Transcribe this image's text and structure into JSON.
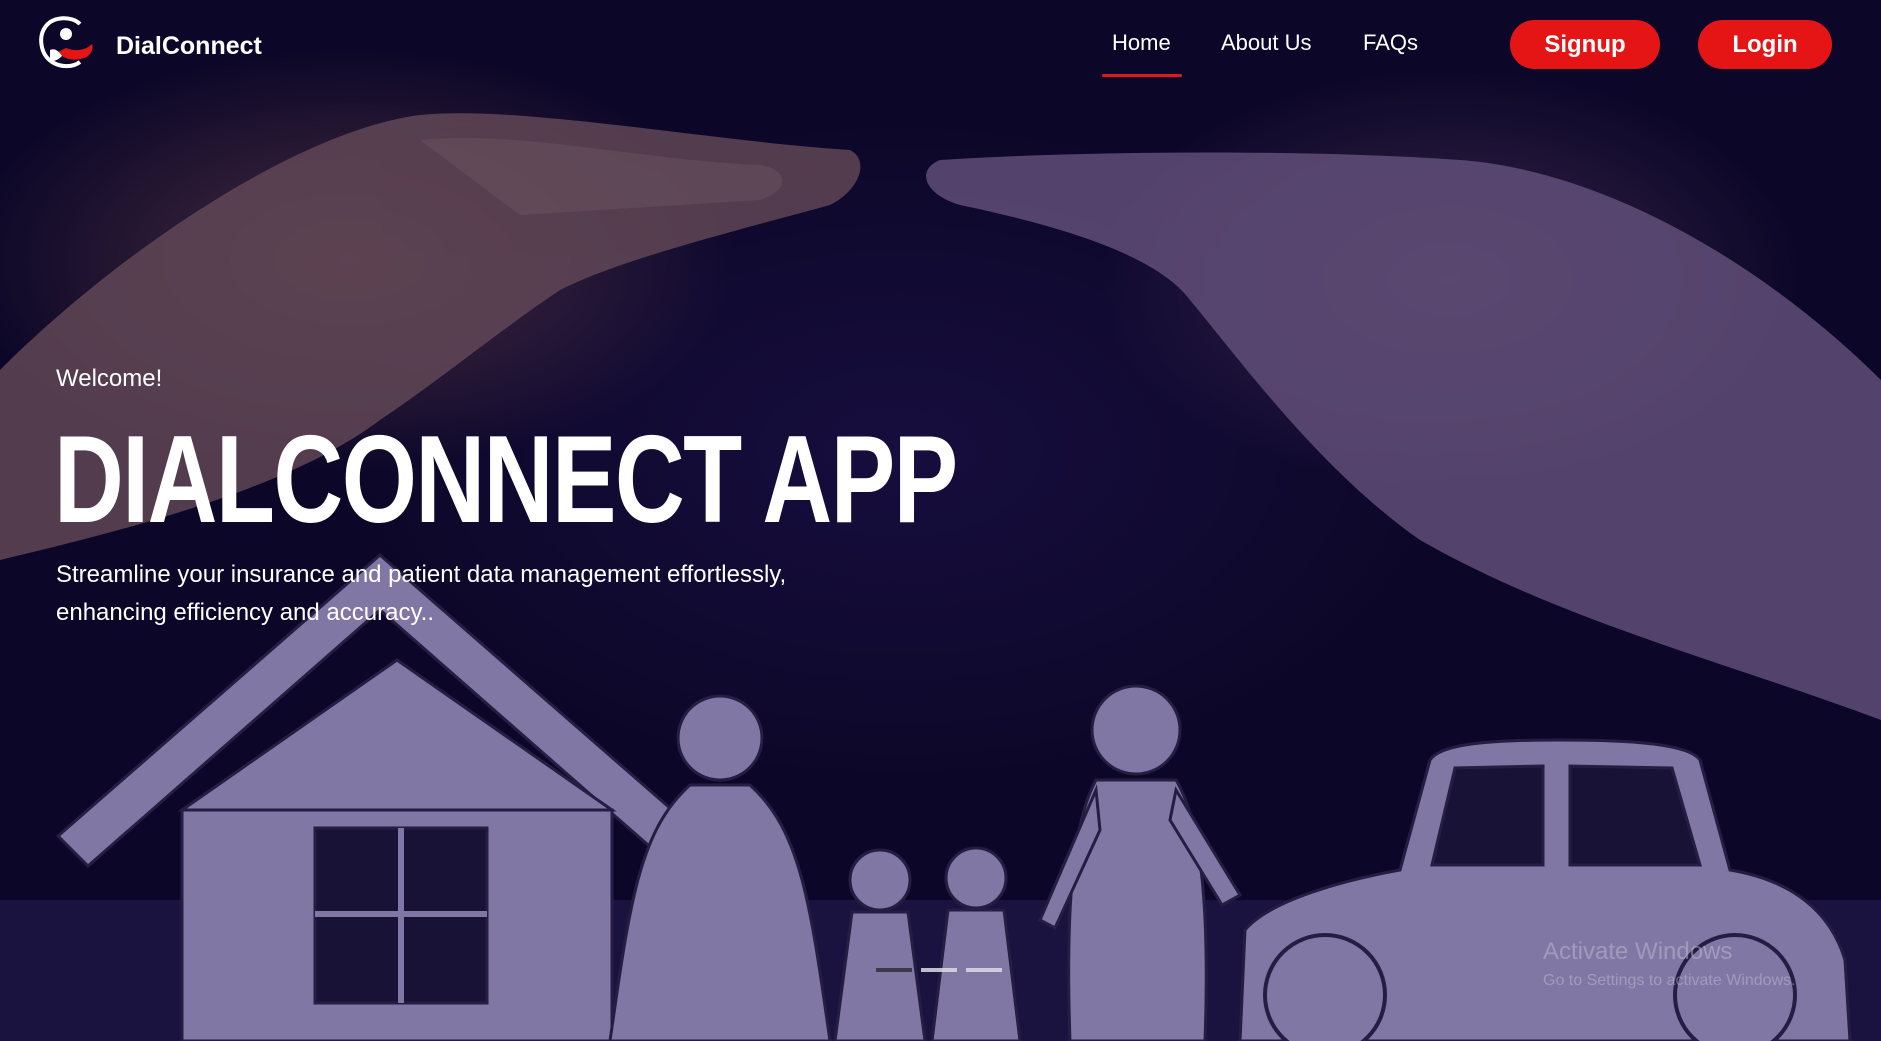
{
  "brand": {
    "name": "DialConnect"
  },
  "nav": {
    "home": "Home",
    "about": "About Us",
    "faqs": "FAQs",
    "active": "Home"
  },
  "auth": {
    "signup": "Signup",
    "login": "Login"
  },
  "hero": {
    "welcome": "Welcome!",
    "title": "DIALCONNECT APP",
    "description": "Streamline your insurance and patient data management effortlessly, enhancing efficiency and accuracy.."
  },
  "carousel": {
    "slides": 3,
    "active_index": 0
  },
  "watermark": {
    "title": "Activate Windows",
    "subtitle": "Go to Settings to activate Windows."
  },
  "colors": {
    "accent": "#e51515",
    "background": "#120c34",
    "text": "#ffffff"
  },
  "icons": {
    "logo": "hand-heart-logo-icon"
  }
}
